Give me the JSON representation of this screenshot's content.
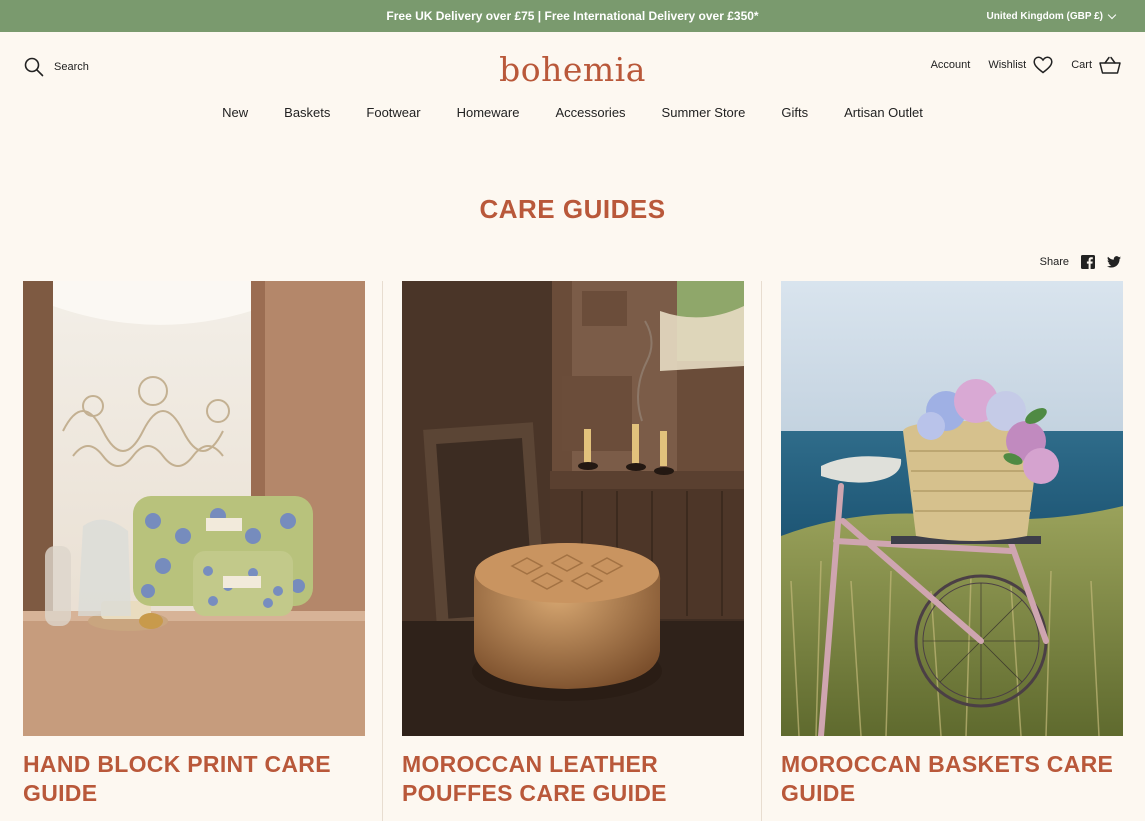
{
  "announcement": {
    "text": "Free UK Delivery over £75 | Free International Delivery over £350*"
  },
  "region": {
    "label": "United Kingdom (GBP £)"
  },
  "header": {
    "search_label": "Search",
    "logo_text": "bohemia",
    "account_label": "Account",
    "wishlist_label": "Wishlist",
    "cart_label": "Cart"
  },
  "nav": [
    {
      "label": "New"
    },
    {
      "label": "Baskets"
    },
    {
      "label": "Footwear"
    },
    {
      "label": "Homeware"
    },
    {
      "label": "Accessories"
    },
    {
      "label": "Summer Store"
    },
    {
      "label": "Gifts"
    },
    {
      "label": "Artisan Outlet"
    }
  ],
  "page": {
    "title": "CARE GUIDES"
  },
  "share": {
    "label": "Share"
  },
  "cards": [
    {
      "title": "HAND BLOCK PRINT CARE GUIDE"
    },
    {
      "title": "MOROCCAN LEATHER POUFFES CARE GUIDE"
    },
    {
      "title": "MOROCCAN BASKETS CARE GUIDE"
    }
  ],
  "colors": {
    "accent": "#b9583a",
    "topbar": "#7a9a6e",
    "background": "#fdf8f1"
  }
}
